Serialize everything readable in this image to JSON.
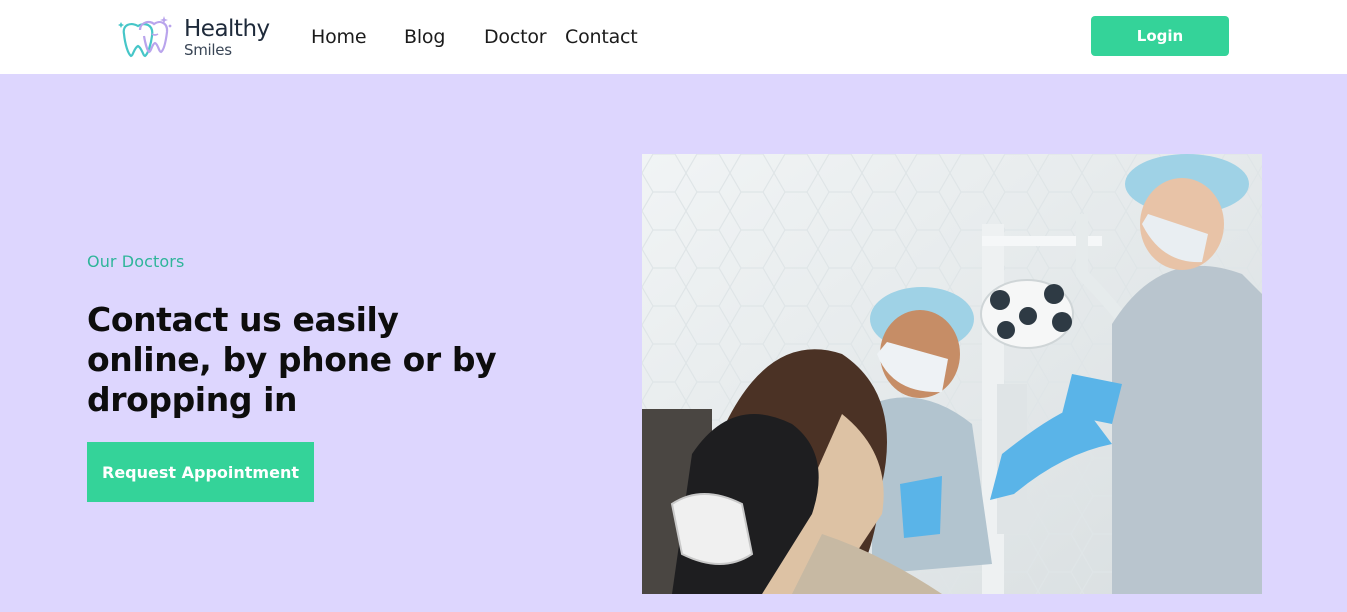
{
  "brand": {
    "name": "Healthy",
    "subtitle": "Smiles"
  },
  "nav": {
    "items": [
      "Home",
      "Blog",
      "Doctor",
      "Contact"
    ]
  },
  "header": {
    "login_label": "Login"
  },
  "hero": {
    "eyebrow": "Our Doctors",
    "headline": "Contact us easily online, by phone or by dropping in",
    "cta_label": "Request Appointment"
  },
  "colors": {
    "accent": "#34d399",
    "hero_bg": "#ddd6fe",
    "eyebrow": "#2fb59a"
  },
  "icons": {
    "logo": "tooth-logo-icon"
  }
}
